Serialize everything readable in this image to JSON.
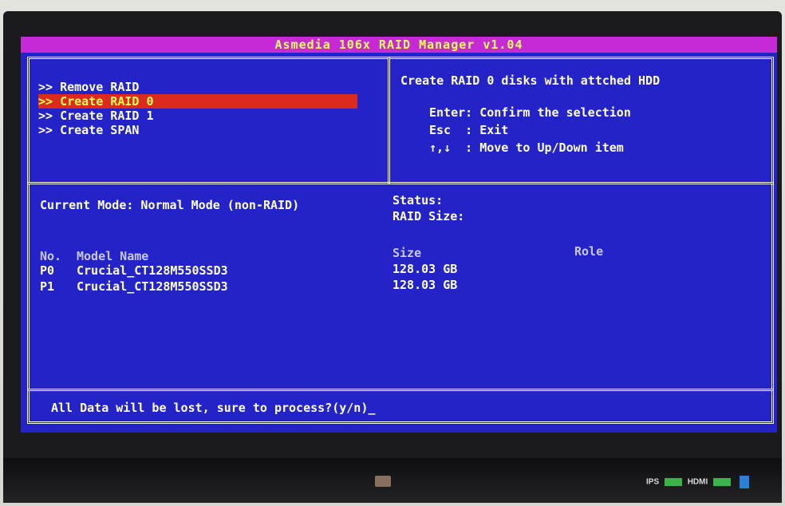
{
  "window": {
    "title": "Asmedia 106x RAID Manager v1.04"
  },
  "menu": {
    "items": [
      {
        "label": ">> Remove RAID",
        "selected": false
      },
      {
        "label": ">> Create RAID 0",
        "selected": true
      },
      {
        "label": ">> Create RAID 1",
        "selected": false
      },
      {
        "label": ">> Create SPAN",
        "selected": false
      }
    ]
  },
  "help": {
    "heading": "Create RAID 0 disks with attched HDD",
    "lines": [
      "Enter: Confirm the selection",
      "Esc  : Exit",
      "↑,↓  : Move to Up/Down item"
    ]
  },
  "info": {
    "current_mode": "Current Mode: Normal Mode (non-RAID)",
    "status_label": "Status:",
    "raid_size_label": "RAID Size:",
    "columns": {
      "no": "No.",
      "model": "Model Name",
      "size": "Size",
      "role": "Role"
    },
    "disks": [
      {
        "no": "P0",
        "model": "Crucial_CT128M550SSD3",
        "size": "128.03 GB",
        "role": ""
      },
      {
        "no": "P1",
        "model": "Crucial_CT128M550SSD3",
        "size": "128.03 GB",
        "role": ""
      }
    ]
  },
  "prompt": {
    "text": "All Data will be lost, sure to process?(y/n)_"
  },
  "bezel": {
    "badge_text": "IPS",
    "hdmi_text": "HDMI"
  },
  "colors": {
    "background": "#2323c7",
    "titlebar": "#c62ad6",
    "title_text": "#ffff55",
    "highlight": "#dd2a1e",
    "text": "#ffffff"
  }
}
